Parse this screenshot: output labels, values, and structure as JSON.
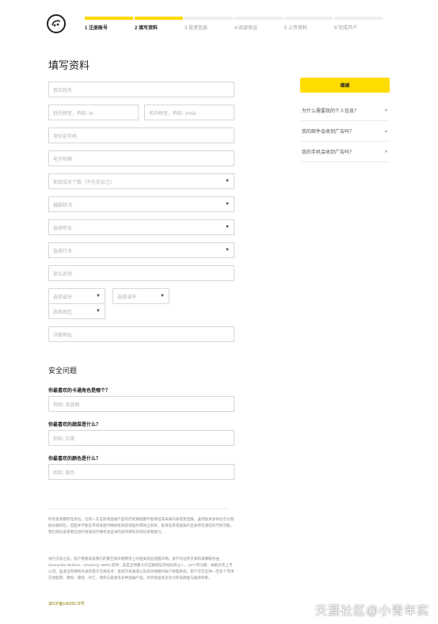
{
  "steps": [
    {
      "label": "1 注册账号",
      "active": true
    },
    {
      "label": "2 填写资料",
      "active": true
    },
    {
      "label": "3 投资信息",
      "active": false
    },
    {
      "label": "4 阅读协议",
      "active": false
    },
    {
      "label": "5 上传资料",
      "active": false
    },
    {
      "label": "6 完成开户",
      "active": false
    }
  ],
  "page_title": "填写资料",
  "form": {
    "real_name": "真实姓名",
    "last_name_pinyin": "姓的拼音，例如: liu",
    "first_name_pinyin": "名的拼音，例如: zhida",
    "id_number": "身份证号码",
    "email": "电子邮箱",
    "family_members": "家庭成员个数（不包括自己）",
    "marital_status": "婚姻状况",
    "occupation": "选择职业",
    "industry": "选择行业",
    "employer": "单位名称",
    "province": "选择省份",
    "city": "选择城市",
    "district": "选择地区",
    "address": "详细地址"
  },
  "security": {
    "title": "安全问题",
    "questions": [
      {
        "label": "你最喜欢的卡通角色是哪个？",
        "placeholder": "例如: 凌波丽"
      },
      {
        "label": "你最喜欢的蔬菜是什么？",
        "placeholder": "例如: 白菜"
      },
      {
        "label": "你最喜欢的颜色是什么？",
        "placeholder": "例如: 黄色"
      }
    ]
  },
  "sidebar": {
    "continue_label": "继续",
    "faq": [
      "为什么需要我的个人信息？",
      "我的邮件会收到广告吗？",
      "我的手机会收到广告吗？"
    ]
  },
  "footer": {
    "para1": "所有投资都存在风险。任何一支证券或金融产品的历史数据都不能保证其未来的表现及回报。虽然投资多样化可以帮助分散风险，但是并不能在市场低迷时确保投资获得盈利或防止损失。投资证券或金融产品会存在潜在的亏损可能。我们建议投资者在进行投资前仔细考虑自身的投资目标及风险承受能力。",
    "para2": "进行交易之前，客户需要阅读我们的警告和声明网页上的相关风险提醒声明。资产的证券交易和清算服务由 (Interactive Brokers、NASDAQ: IBKR) 提供，其是全球最大的互联网证券经纪商之一，1977年创建，纳斯达克上市公司。盈透证券拥有先进的电子交易技术、直接交易通道以及高效便捷的账户管理系统。客户可在全球一百多个市场交易股票、期权、期货、外汇、债券与基金等多种金融产品，并享受极具竞争力的低佣金与融资利率。",
    "icp": "京ICP备14039179号"
  },
  "watermark": "天涯社区@小青年实"
}
